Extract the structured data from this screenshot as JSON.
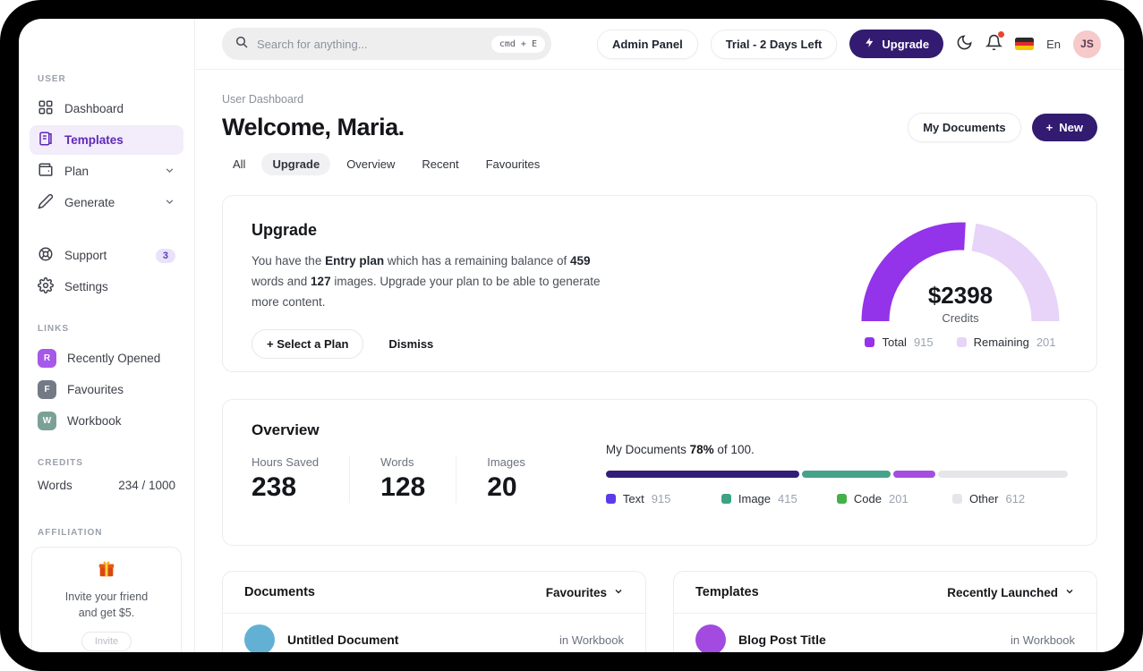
{
  "colors": {
    "brand_deep_purple": "#321b70",
    "active_item_bg": "#f2ecfb",
    "active_item_text": "#5f29b7",
    "gauge_total": "#9333ea",
    "gauge_remaining": "#e7d4f8",
    "notification_dot": "#e8442f"
  },
  "topbar": {
    "search": {
      "placeholder": "Search for anything...",
      "shortcut": "cmd + E"
    },
    "admin_panel_label": "Admin Panel",
    "trial_label": "Trial - 2 Days Left",
    "upgrade_label": "Upgrade",
    "language_label": "En",
    "avatar_initials": "JS"
  },
  "sidebar": {
    "section_user": "USER",
    "section_links": "LINKS",
    "section_credits": "CREDITS",
    "section_affiliation": "AFFILIATION",
    "nav": [
      {
        "label": "Dashboard"
      },
      {
        "label": "Templates"
      },
      {
        "label": "Plan"
      },
      {
        "label": "Generate"
      }
    ],
    "support_label": "Support",
    "support_badge": "3",
    "settings_label": "Settings",
    "links": [
      {
        "initial": "R",
        "label": "Recently Opened",
        "color": "#a658e8"
      },
      {
        "initial": "F",
        "label": "Favourites",
        "color": "#737a85"
      },
      {
        "initial": "W",
        "label": "Workbook",
        "color": "#7ba095"
      }
    ],
    "credits": {
      "label": "Words",
      "value": "234 / 1000",
      "fill_width": "23.4%"
    },
    "affiliation": {
      "line1": "Invite your friend",
      "line2": "and get $5.",
      "button_label": "Invite"
    }
  },
  "page": {
    "breadcrumb": "User Dashboard",
    "title": "Welcome, Maria.",
    "tabs": [
      {
        "label": "All"
      },
      {
        "label": "Upgrade"
      },
      {
        "label": "Overview"
      },
      {
        "label": "Recent"
      },
      {
        "label": "Favourites"
      }
    ],
    "my_documents_label": "My Documents",
    "new_label": "New"
  },
  "upgrade_card": {
    "title": "Upgrade",
    "body": {
      "p1": "You have the ",
      "b1": "Entry plan",
      "p2": " which has a remaining balance of ",
      "b2": "459",
      "p3": " words and ",
      "b3": "127",
      "p4": " images. Upgrade your plan to be able to generate more content."
    },
    "select_plan_label": "+ Select a Plan",
    "dismiss_label": "Dismiss",
    "gauge": {
      "center_value": "$2398",
      "center_label": "Credits",
      "legend": [
        {
          "name": "Total",
          "value": "915",
          "color": "#9333ea"
        },
        {
          "name": "Remaining",
          "value": "201",
          "color": "#e7d4f8"
        }
      ]
    }
  },
  "overview_card": {
    "title": "Overview",
    "stats": [
      {
        "label": "Hours Saved",
        "value": "238"
      },
      {
        "label": "Words",
        "value": "128"
      },
      {
        "label": "Images",
        "value": "20"
      }
    ],
    "progress": {
      "prefix": "My Documents ",
      "percent": "78%",
      "suffix": " of 100.",
      "segments": [
        {
          "name": "Text",
          "value": "915",
          "width": "42.7%",
          "color": "#341d77",
          "legend_color": "#5b3be8"
        },
        {
          "name": "Image",
          "value": "415",
          "width": "19.4%",
          "color": "#46a28b",
          "legend_color": "#3ba284"
        },
        {
          "name": "Code",
          "value": "201",
          "width": "9.4%",
          "color": "#a44ee0",
          "legend_color": "#43b048"
        },
        {
          "name": "Other",
          "value": "612",
          "width": "28.5%",
          "color": "#e6e6ea",
          "legend_color": "#e6e6ea"
        }
      ]
    }
  },
  "documents_card": {
    "title": "Documents",
    "filter_label": "Favourites",
    "rows": [
      {
        "name": "Untitled Document",
        "location": "in Workbook",
        "avatar_color": "#62b1d4"
      }
    ]
  },
  "templates_card": {
    "title": "Templates",
    "filter_label": "Recently Launched",
    "rows": [
      {
        "name": "Blog Post Title",
        "location": "in Workbook",
        "avatar_color": "#a34ae0"
      }
    ]
  },
  "chart_data": [
    {
      "type": "donut-gauge",
      "title": "Credits",
      "center_value": "$2398",
      "series": [
        {
          "name": "Total",
          "value": 915,
          "color": "#9333ea"
        },
        {
          "name": "Remaining",
          "value": 201,
          "color": "#e7d4f8"
        }
      ],
      "layout": "half-donut, gap near top, legend below"
    },
    {
      "type": "stacked-bar",
      "title": "My Documents 78% of 100.",
      "series": [
        {
          "name": "Text",
          "value": 915,
          "color": "#341d77"
        },
        {
          "name": "Image",
          "value": 415,
          "color": "#46a28b"
        },
        {
          "name": "Code",
          "value": 201,
          "color": "#a44ee0"
        },
        {
          "name": "Other",
          "value": 612,
          "color": "#e6e6ea"
        }
      ],
      "layout": "horizontal single bar, legend below"
    }
  ]
}
